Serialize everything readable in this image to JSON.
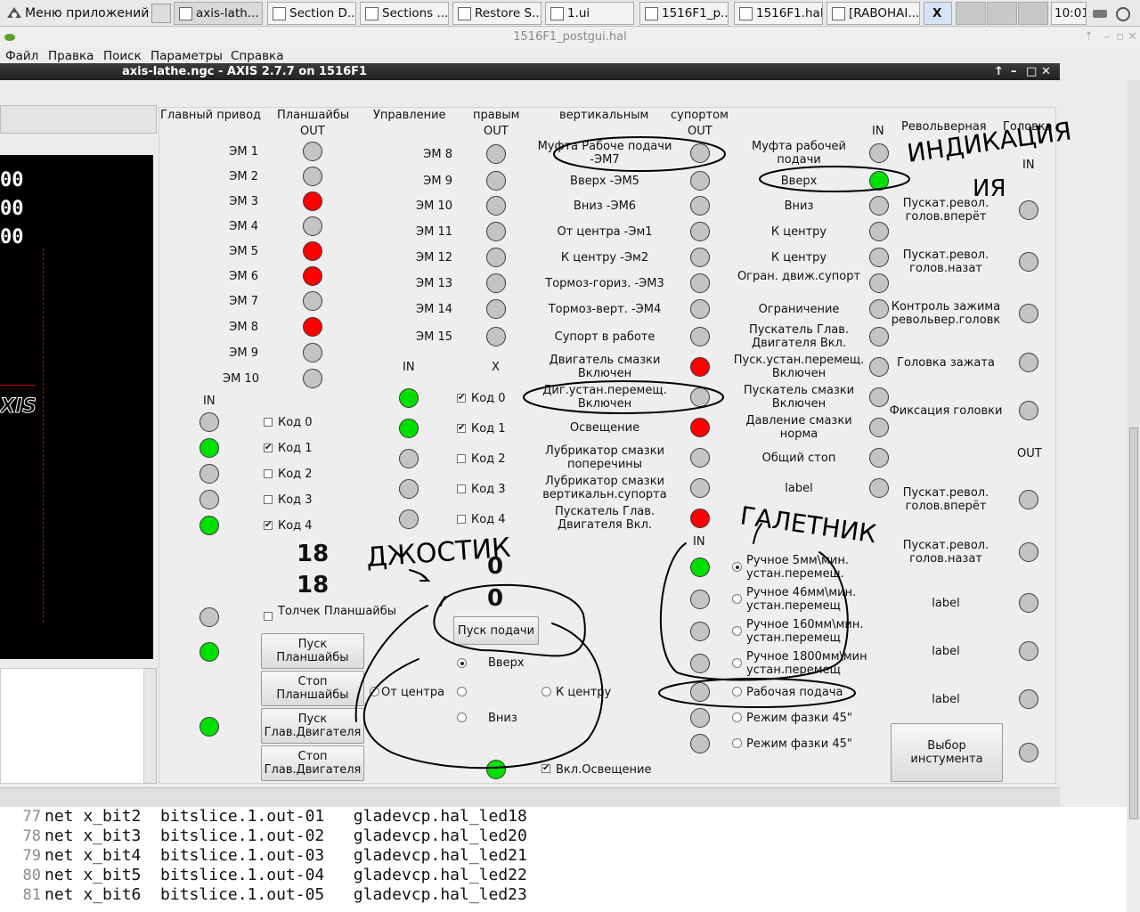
{
  "taskbar": {
    "app_menu": "Меню приложений",
    "tasks": [
      "axis-lath...",
      "Section D...",
      "Sections ...",
      "Restore S...",
      "1.ui",
      "1516F1_p...",
      "1516F1.hal",
      "[RABOHAI..."
    ],
    "clock": "10:01"
  },
  "editor": {
    "title": "1516F1_postgui.hal",
    "menu": [
      "Файл",
      "Правка",
      "Поиск",
      "Параметры",
      "Справка"
    ],
    "lines": [
      {
        "n": "77",
        "text": "net x_bit2  bitslice.1.out-01   gladevcp.hal_led18"
      },
      {
        "n": "78",
        "text": "net x_bit3  bitslice.1.out-02   gladevcp.hal_led20"
      },
      {
        "n": "79",
        "text": "net x_bit4  bitslice.1.out-03   gladevcp.hal_led21"
      },
      {
        "n": "80",
        "text": "net x_bit5  bitslice.1.out-04   gladevcp.hal_led22"
      },
      {
        "n": "81",
        "text": "net x_bit6  bitslice.1.out-05   gladevcp.hal_led23"
      }
    ]
  },
  "axis": {
    "title": "axis-lathe.ngc - AXIS 2.7.7 on 1516F1",
    "dro": [
      "00",
      "00",
      "00"
    ],
    "logo": "XIS"
  },
  "headers": {
    "main_drive": "Главный привод",
    "faceplate": "Планшайбы",
    "control": "Управление",
    "right": "правым",
    "vertical": "вертикальным",
    "support": "супортом",
    "turret": "Револьверная",
    "head": "Головка",
    "out1": "OUT",
    "out2": "OUT",
    "out3": "OUT",
    "in_col7": "IN",
    "in_head": "IN",
    "out_head": "OUT",
    "in_left": "IN",
    "in_mid": "IN",
    "x_mid": "X",
    "in_gal": "IN"
  },
  "col1": {
    "labels": [
      "ЭМ 1",
      "ЭМ 2",
      "ЭМ 3",
      "ЭМ 4",
      "ЭМ 5",
      "ЭМ 6",
      "ЭМ 7",
      "ЭМ 8",
      "ЭМ 9",
      "ЭМ 10"
    ],
    "states": [
      "off",
      "off",
      "red",
      "off",
      "red",
      "red",
      "off",
      "red",
      "off",
      "off"
    ]
  },
  "col2": {
    "labels": [
      "ЭМ 8",
      "ЭМ 9",
      "ЭМ 10",
      "ЭМ 11",
      "ЭМ 12",
      "ЭМ 13",
      "ЭМ 14",
      "ЭМ 15"
    ],
    "states": [
      "off",
      "off",
      "off",
      "off",
      "off",
      "off",
      "off",
      "off"
    ]
  },
  "col3": {
    "labels": [
      "Муфта Рабоче подачи -ЭМ7",
      "Вверх -ЭМ5",
      "Вниз -ЭМ6",
      "От центра -Эм1",
      "К центру -Эм2",
      "Тормоз-гориз. -ЭМ3",
      "Тормоз-верт. -ЭМ4",
      "Супорт в работе",
      "Двигатель смазки Включен",
      "Диг.устан.перемещ. Включен",
      "Освещение",
      "Лубрикатор смазки поперечины",
      "Лубрикатор смазки вертикальн.супорта",
      "Пускатель Глав. Двигателя Вкл."
    ],
    "states": [
      "off",
      "off",
      "off",
      "off",
      "off",
      "off",
      "off",
      "off",
      "red",
      "off",
      "red",
      "off",
      "off",
      "red"
    ]
  },
  "col4": {
    "labels": [
      "Муфта рабочей подачи",
      "Вверх",
      "Вниз",
      "К центру",
      "К центру",
      "Огран. движ.супорт",
      "Ограничение",
      "Пускатель Глав. Двигателя Вкл.",
      "Пуск.устан.перемещ. Включен",
      "Пускатель смазки Включен",
      "Давление смазки норма",
      "Общий стоп",
      "label"
    ],
    "states": [
      "off",
      "green",
      "off",
      "off",
      "off",
      "off",
      "off",
      "off",
      "off",
      "off",
      "off",
      "off",
      "off"
    ]
  },
  "col5": {
    "labels_in": [
      "Пускат.револ. голов.вперёт",
      "Пускат.револ. голов.назат",
      "Контроль зажима револьвер.головк",
      "Головка зажата",
      "Фиксация головки"
    ],
    "labels_out": [
      "Пускат.револ. голов.вперёт",
      "Пускат.револ. голов.назат",
      "label",
      "label",
      "label"
    ]
  },
  "codes_left": [
    {
      "label": "Код 0",
      "checked": false,
      "led": "off"
    },
    {
      "label": "Код 1",
      "checked": true,
      "led": "green"
    },
    {
      "label": "Код 2",
      "checked": false,
      "led": "off"
    },
    {
      "label": "Код 3",
      "checked": false,
      "led": "off"
    },
    {
      "label": "Код 4",
      "checked": true,
      "led": "green"
    }
  ],
  "codes_mid": [
    {
      "label": "Код 0",
      "checked": true,
      "led": "green"
    },
    {
      "label": "Код 1",
      "checked": true,
      "led": "green"
    },
    {
      "label": "Код 2",
      "checked": false,
      "led": "off"
    },
    {
      "label": "Код 3",
      "checked": false,
      "led": "off"
    },
    {
      "label": "Код 4",
      "checked": false,
      "led": "off"
    }
  ],
  "counters": {
    "left_a": "18",
    "left_b": "18",
    "mid_a": "0",
    "mid_b": "0"
  },
  "faceplate_ctrl": {
    "jog_label": "Толчек Планшайбы",
    "start": "Пуск Планшайбы",
    "stop": "Стоп Планшайбы",
    "motor_start": "Пуск Глав.Двигателя",
    "motor_stop": "Стоп Глав.Двигателя"
  },
  "joystick": {
    "feed_button": "Пуск подачи",
    "up": "Вверх",
    "down": "Вниз",
    "from_center": "От центра",
    "to_center": "К центру",
    "light": "Вкл.Освещение"
  },
  "galetnik": {
    "options": [
      "Ручное 5мм\\мин. устан.перемещ.",
      "Ручное 46мм\\мин. устан.перемещ",
      "Ручное 160мм\\мин. устан.перемещ",
      "Ручное 1800мм\\мин устан.перемещ",
      "Рабочая подача",
      "Режим фазки 45\"",
      "Режим фазки 45\""
    ],
    "selected": 0
  },
  "tool_button": "Выбор инстумента",
  "annotations": {
    "indication": "ИНДИКАЦИЯ",
    "joystick": "ДЖОСТИК",
    "galetnik": "ГАЛЕТНИК"
  }
}
